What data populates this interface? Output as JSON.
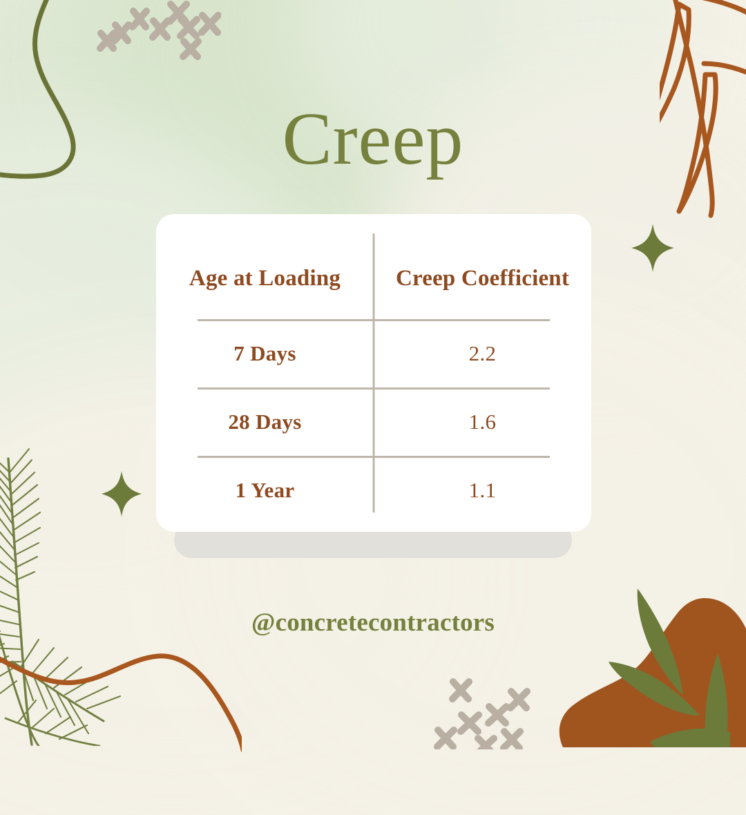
{
  "title": "Creep",
  "handle": "@concretecontractors",
  "colors": {
    "background": "#F4F1E6",
    "wash_green": "#DDE8D4",
    "title_green": "#77813E",
    "text_brown": "#8E4A20",
    "divider_taupe": "#BFB6AA",
    "card_white": "#FFFFFF",
    "card_shadow": "#E2E0DA",
    "leaf_green": "#6C7A3A",
    "branch_brown": "#A8571F"
  },
  "table": {
    "headers": [
      "Age at Loading",
      "Creep Coefficient"
    ],
    "rows": [
      {
        "label": "7 Days",
        "value": "2.2"
      },
      {
        "label": "28 Days",
        "value": "1.6"
      },
      {
        "label": "1 Year",
        "value": "1.1"
      }
    ]
  },
  "chart_data": {
    "type": "table",
    "title": "Creep",
    "categories": [
      "7 Days",
      "28 Days",
      "1 Year"
    ],
    "values": [
      2.2,
      1.6,
      1.1
    ],
    "xlabel": "Age at Loading",
    "ylabel": "Creep Coefficient",
    "columns": [
      "Age at Loading",
      "Creep Coefficient"
    ],
    "rows": [
      [
        "7 Days",
        "2.2"
      ],
      [
        "28 Days",
        "1.6"
      ],
      [
        "1 Year",
        "1.1"
      ]
    ]
  },
  "decorations": [
    {
      "name": "blob-outline-top-left",
      "icon": "curved-blob-outline-icon",
      "color": "#6B7436"
    },
    {
      "name": "plus-cluster-top-left",
      "icon": "plus-marks-icon",
      "color": "#B9AFA3"
    },
    {
      "name": "leaf-branch-top-right",
      "icon": "eucalyptus-branch-icon",
      "color": "#A8571F"
    },
    {
      "name": "sparkle-top-right",
      "icon": "four-point-star-icon",
      "color": "#6C7A3A"
    },
    {
      "name": "pine-frond-bottom-left",
      "icon": "pine-frond-icon",
      "color": "#6C7A3A"
    },
    {
      "name": "sparkle-bottom-left",
      "icon": "four-point-star-icon",
      "color": "#6C7A3A"
    },
    {
      "name": "wavy-line-bottom-left",
      "icon": "wavy-line-icon",
      "color": "#A8571F"
    },
    {
      "name": "plus-cluster-bottom",
      "icon": "plus-marks-icon",
      "color": "#B9AFA3"
    },
    {
      "name": "blob-leaves-bottom-right",
      "icon": "leafy-blob-icon",
      "color": "#A0551F"
    }
  ]
}
